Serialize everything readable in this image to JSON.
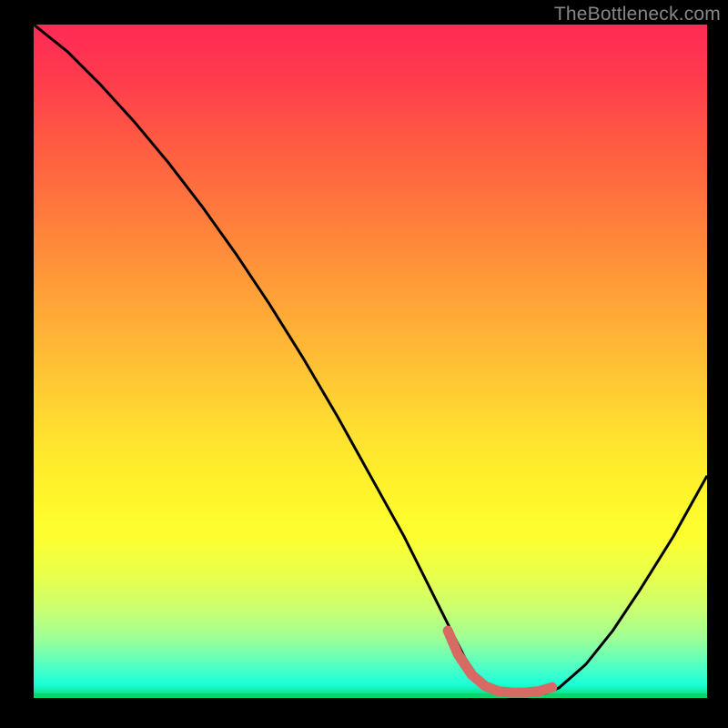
{
  "watermark": "TheBottleneck.com",
  "colors": {
    "curve": "#000000",
    "accent": "#d86a64",
    "background_black": "#000000",
    "gradient_top": "#ff2a55",
    "gradient_bottom": "#0cd66a"
  },
  "chart_data": {
    "type": "line",
    "title": "",
    "xlabel": "",
    "ylabel": "",
    "xlim": [
      0,
      100
    ],
    "ylim": [
      0,
      100
    ],
    "grid": false,
    "legend": false,
    "series": [
      {
        "name": "bottleneck-curve",
        "x": [
          0,
          5,
          10,
          15,
          20,
          25,
          30,
          35,
          40,
          45,
          50,
          55,
          60,
          62,
          64,
          66,
          68,
          70,
          72,
          74,
          76,
          78,
          82,
          86,
          90,
          95,
          100
        ],
        "y": [
          100,
          96,
          91,
          85.5,
          79.5,
          73,
          66,
          58.5,
          50.5,
          42,
          33,
          24,
          14,
          10,
          6,
          3,
          1.5,
          0.8,
          0.5,
          0.5,
          0.7,
          1.5,
          5,
          10,
          16,
          24,
          33
        ]
      },
      {
        "name": "accent-segment",
        "x": [
          61.5,
          63,
          65,
          67,
          69,
          71,
          73,
          75,
          77
        ],
        "y": [
          10,
          6.5,
          3.5,
          1.8,
          1.0,
          0.8,
          0.8,
          1.0,
          1.6
        ]
      }
    ],
    "annotations": []
  }
}
